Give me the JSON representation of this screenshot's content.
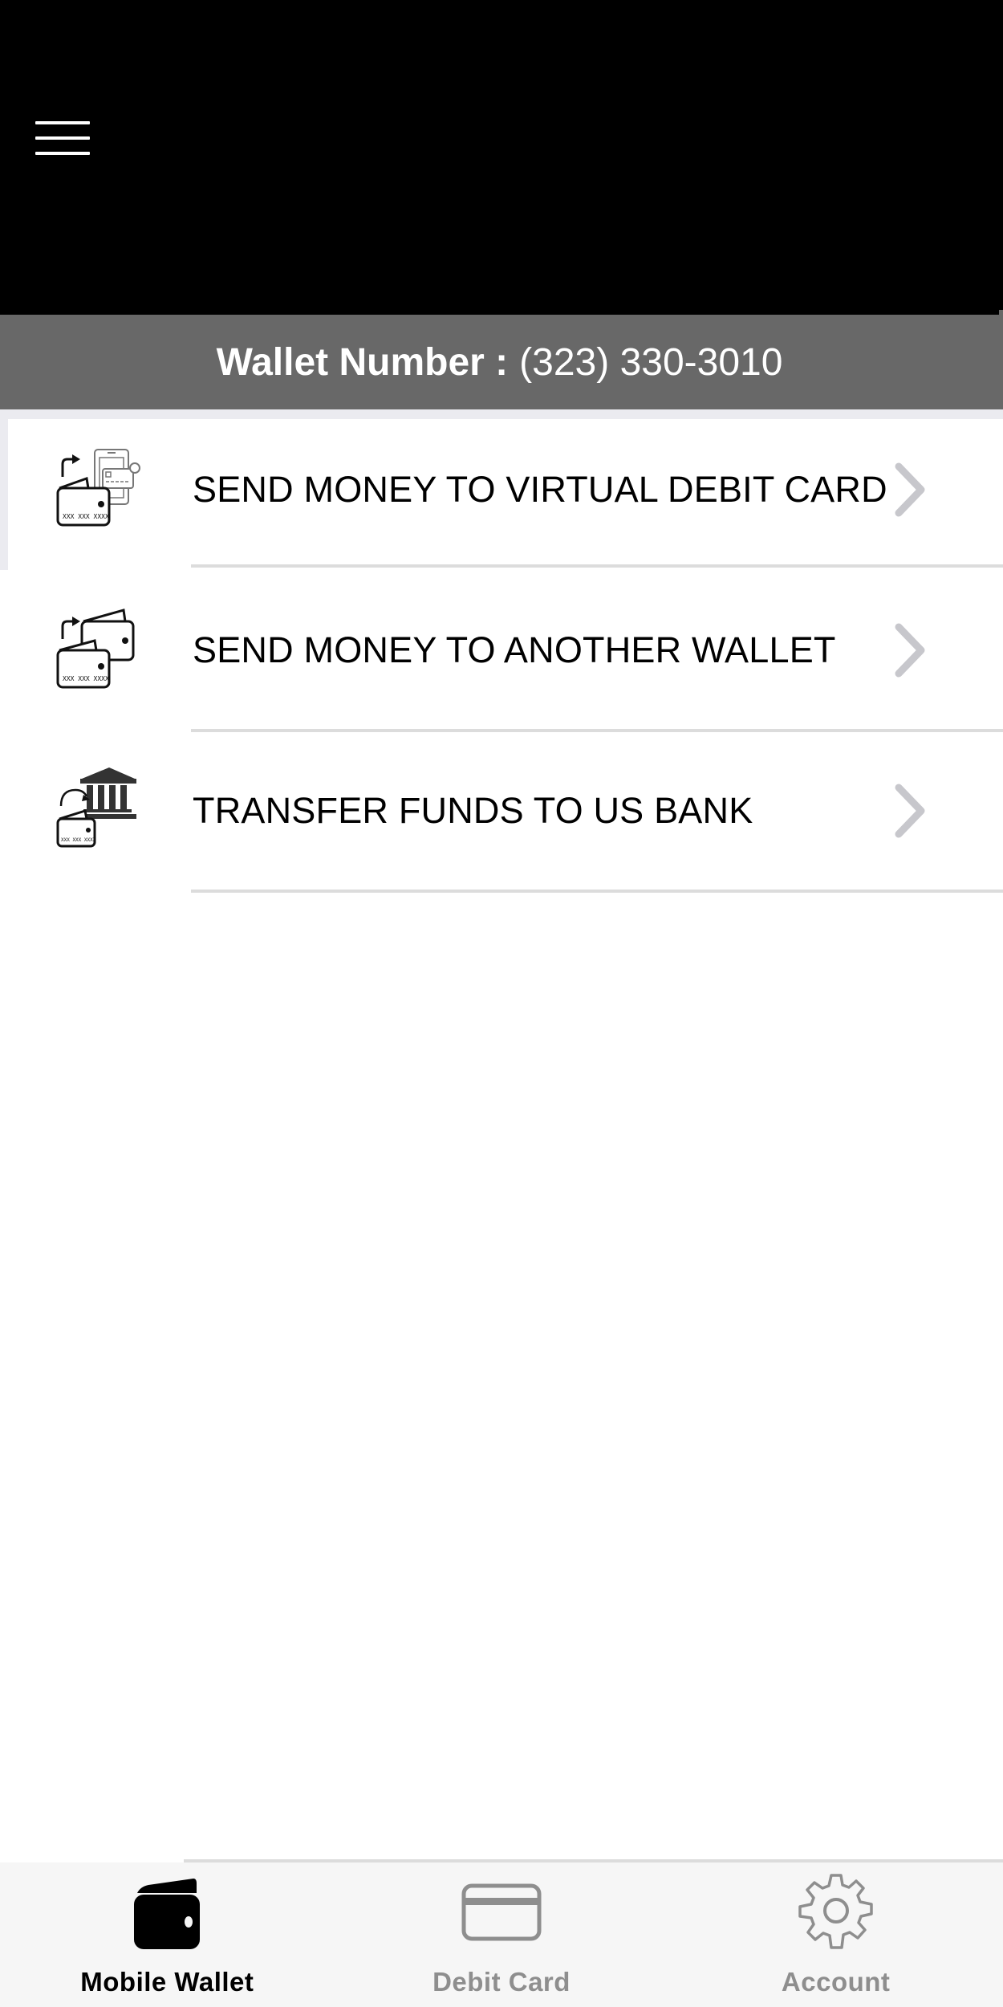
{
  "header": {
    "menu_icon": "hamburger-menu-icon"
  },
  "wallet_banner": {
    "label": "Wallet Number :",
    "value": "(323) 330-3010"
  },
  "menu": {
    "items": [
      {
        "label": "SEND MONEY TO VIRTUAL DEBIT CARD",
        "icon": "wallet-to-virtual-card-icon",
        "chevron": "chevron-right-icon"
      },
      {
        "label": "SEND MONEY TO ANOTHER WALLET",
        "icon": "wallet-to-wallet-icon",
        "chevron": "chevron-right-icon"
      },
      {
        "label": "TRANSFER FUNDS TO US BANK",
        "icon": "wallet-to-bank-icon",
        "chevron": "chevron-right-icon"
      }
    ]
  },
  "tabbar": {
    "tabs": [
      {
        "label": "Mobile Wallet",
        "icon": "wallet-icon",
        "active": true
      },
      {
        "label": "Debit Card",
        "icon": "credit-card-icon",
        "active": false
      },
      {
        "label": "Account",
        "icon": "gear-icon",
        "active": false
      }
    ]
  },
  "colors": {
    "header_bg": "#000000",
    "banner_bg": "#686868",
    "highlight_bg": "#ebebf0",
    "chevron": "#c7c7cc",
    "separator": "#dcdcdc",
    "tab_active": "#000000",
    "tab_inactive": "#8e8e8e",
    "tabbar_bg": "#f6f6f6"
  }
}
